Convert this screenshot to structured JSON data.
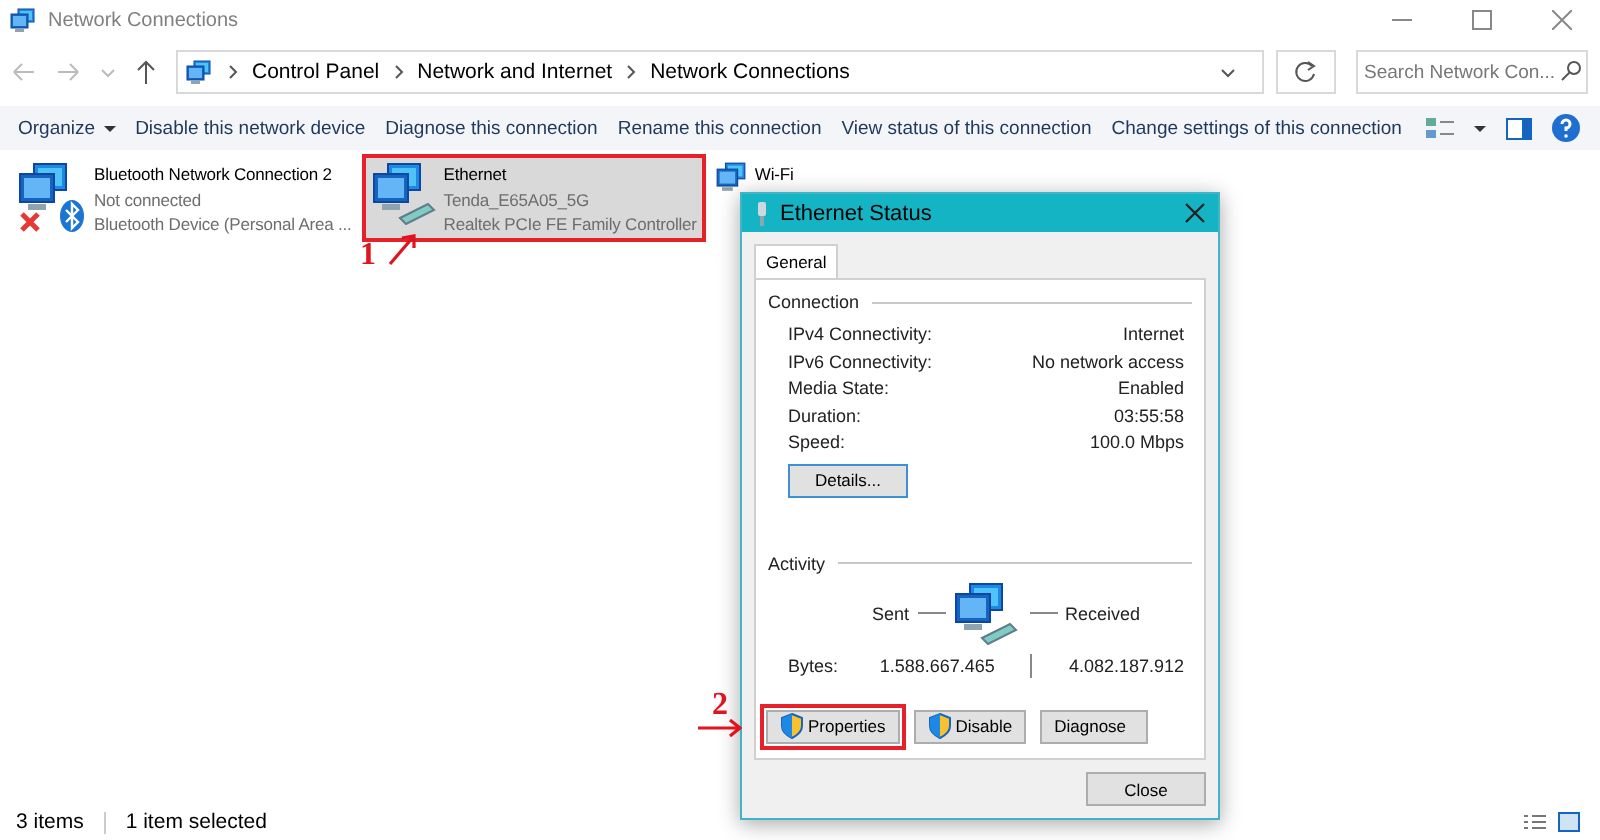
{
  "window": {
    "title": "Network Connections"
  },
  "address_bar": {
    "breadcrumbs": [
      "Control Panel",
      "Network and Internet",
      "Network Connections"
    ]
  },
  "search": {
    "placeholder": "Search Network Con..."
  },
  "toolbar": [
    {
      "label": "Organize",
      "kind": "menu"
    },
    {
      "label": "Disable this network device",
      "kind": "command"
    },
    {
      "label": "Diagnose this connection",
      "kind": "command"
    },
    {
      "label": "Rename this connection",
      "kind": "command"
    },
    {
      "label": "View status of this connection",
      "kind": "command"
    },
    {
      "label": "Change settings of this connection",
      "kind": "command"
    }
  ],
  "connections": [
    {
      "kind": "bluetooth",
      "name": "Bluetooth Network Connection 2",
      "status": "Not connected",
      "device": "Bluetooth Device (Personal Area ...",
      "selected": false,
      "highlighted": false
    },
    {
      "kind": "ethernet",
      "name": "Ethernet",
      "status": "Tenda_E65A05_5G",
      "device": "Realtek PCIe FE Family Controller",
      "selected": true,
      "highlighted": true
    },
    {
      "kind": "wifi",
      "name": "Wi-Fi",
      "selected": false,
      "highlighted": false
    }
  ],
  "dialog": {
    "title": "Ethernet Status",
    "tabs": [
      {
        "label": "General",
        "selected": true
      }
    ],
    "connection": {
      "heading": "Connection",
      "rows": [
        {
          "label": "IPv4 Connectivity:",
          "value": "Internet"
        },
        {
          "label": "IPv6 Connectivity:",
          "value": "No network access"
        },
        {
          "label": "Media State:",
          "value": "Enabled"
        },
        {
          "label": "Duration:",
          "value": "03:55:58"
        },
        {
          "label": "Speed:",
          "value": "100.0 Mbps"
        }
      ],
      "details_button": "Details..."
    },
    "activity": {
      "heading": "Activity",
      "sent_label": "Sent",
      "received_label": "Received",
      "bytes_label": "Bytes:",
      "sent": "1.588.667.465",
      "received": "4.082.187.912"
    },
    "buttons": [
      {
        "label": "Properties",
        "shield": true,
        "highlighted": true
      },
      {
        "label": "Disable",
        "shield": true,
        "highlighted": false
      },
      {
        "label": "Diagnose",
        "shield": false,
        "highlighted": false
      }
    ],
    "close_button": "Close"
  },
  "annotations": [
    {
      "label": "1"
    },
    {
      "label": "2"
    }
  ],
  "status_bar": {
    "count": "3 items",
    "selection": "1 item selected"
  }
}
